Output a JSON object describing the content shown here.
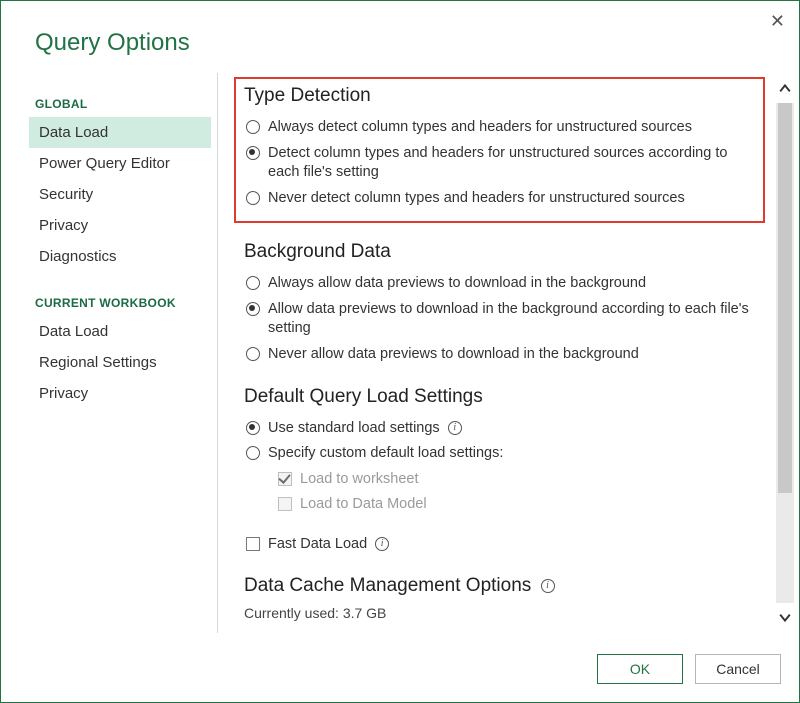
{
  "dialog": {
    "title": "Query Options"
  },
  "sidebar": {
    "sections": [
      {
        "header": "GLOBAL",
        "items": [
          {
            "label": "Data Load",
            "active": true
          },
          {
            "label": "Power Query Editor"
          },
          {
            "label": "Security"
          },
          {
            "label": "Privacy"
          },
          {
            "label": "Diagnostics"
          }
        ]
      },
      {
        "header": "CURRENT WORKBOOK",
        "items": [
          {
            "label": "Data Load"
          },
          {
            "label": "Regional Settings"
          },
          {
            "label": "Privacy"
          }
        ]
      }
    ]
  },
  "type_detection": {
    "title": "Type Detection",
    "options": [
      "Always detect column types and headers for unstructured sources",
      "Detect column types and headers for unstructured sources according to each file's setting",
      "Never detect column types and headers for unstructured sources"
    ],
    "selected_index": 1
  },
  "background_data": {
    "title": "Background Data",
    "options": [
      "Always allow data previews to download in the background",
      "Allow data previews to download in the background according to each file's setting",
      "Never allow data previews to download in the background"
    ],
    "selected_index": 1
  },
  "default_load": {
    "title": "Default Query Load Settings",
    "options": [
      "Use standard load settings",
      "Specify custom default load settings:"
    ],
    "selected_index": 0,
    "sub": {
      "worksheet": "Load to worksheet",
      "datamodel": "Load to Data Model",
      "worksheet_checked": true,
      "datamodel_checked": false
    },
    "fast_load": {
      "label": "Fast Data Load",
      "checked": false
    }
  },
  "cache": {
    "title": "Data Cache Management Options",
    "current_label": "Currently used: 3.7 GB"
  },
  "buttons": {
    "ok": "OK",
    "cancel": "Cancel"
  }
}
